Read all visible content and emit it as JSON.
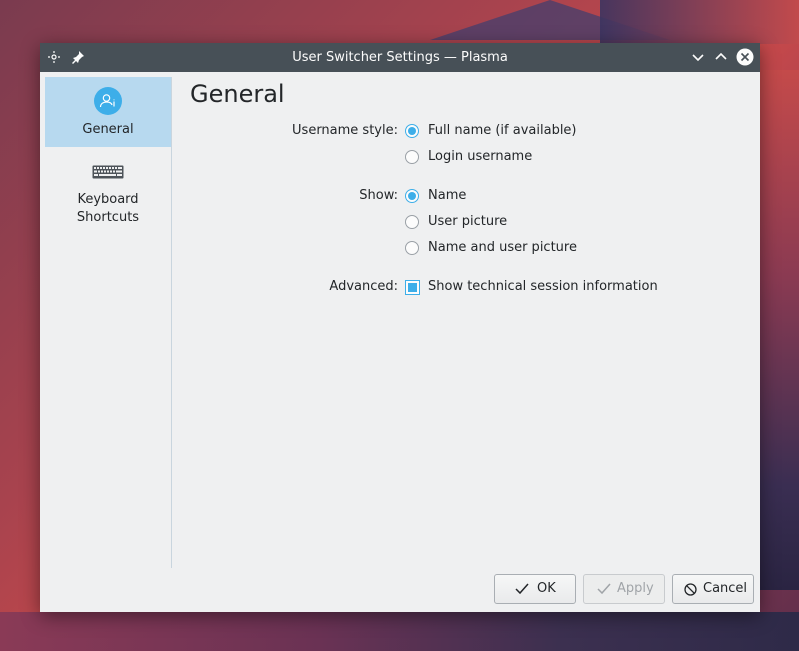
{
  "window": {
    "title": "User Switcher Settings — Plasma"
  },
  "sidebar": {
    "items": [
      {
        "label": "General",
        "icon": "user-settings-icon"
      },
      {
        "label": "Keyboard",
        "label2": "Shortcuts",
        "icon": "keyboard-icon"
      }
    ]
  },
  "page": {
    "title": "General",
    "username_style": {
      "label": "Username style:",
      "options": [
        "Full name (if available)",
        "Login username"
      ],
      "selected": 0
    },
    "show": {
      "label": "Show:",
      "options": [
        "Name",
        "User picture",
        "Name and user picture"
      ],
      "selected": 0
    },
    "advanced": {
      "label": "Advanced:",
      "checkbox": "Show technical session information",
      "checked": true
    }
  },
  "buttons": {
    "ok": "OK",
    "apply": "Apply",
    "cancel": "Cancel"
  },
  "colors": {
    "accent": "#3daee9",
    "titlebar": "#475057",
    "selection": "#b7d9ef"
  }
}
